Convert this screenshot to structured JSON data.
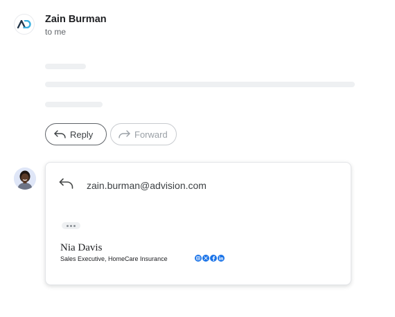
{
  "message": {
    "sender_name": "Zain Burman",
    "recipient_line": "to me"
  },
  "actions": {
    "reply_label": "Reply",
    "forward_label": "Forward"
  },
  "compose": {
    "to_address": "zain.burman@advision.com"
  },
  "signature": {
    "name": "Nia Davis",
    "title": "Sales Executive, HomeCare Insurance",
    "social_icons": [
      "instagram-icon",
      "x-icon",
      "facebook-icon",
      "linkedin-icon"
    ]
  },
  "colors": {
    "social_blue": "#1a73e8",
    "logo_dark": "#24364a",
    "logo_light": "#3ab0e0"
  }
}
